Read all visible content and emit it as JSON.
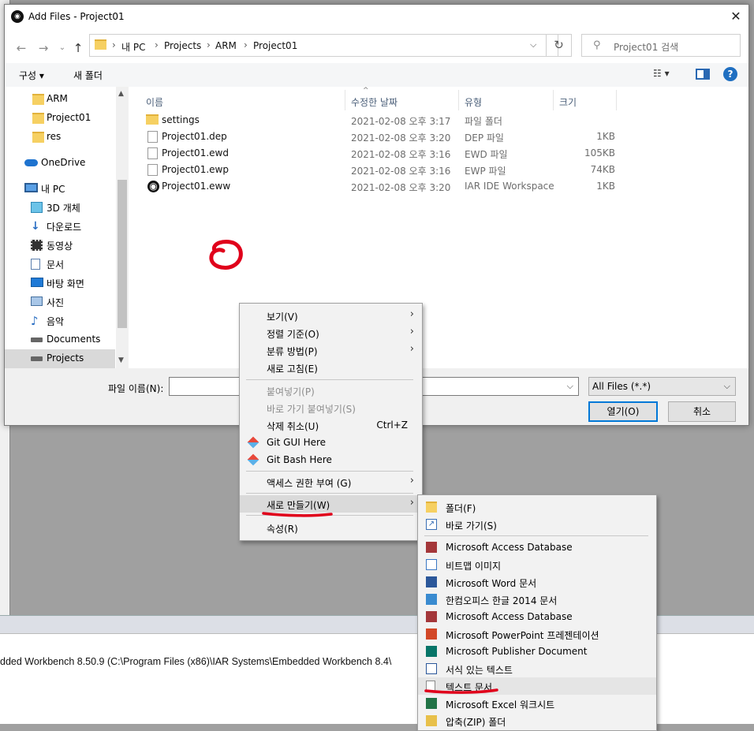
{
  "background": {
    "log_text": "dded Workbench 8.50.9 (C:\\Program Files (x86)\\IAR Systems\\Embedded Workbench 8.4\\"
  },
  "dialog": {
    "title": "Add Files - Project01",
    "close_glyph": "✕",
    "nav": {
      "back": "←",
      "forward": "→",
      "recent": "⌄",
      "up": "↑"
    },
    "breadcrumbs": [
      "내 PC",
      "Projects",
      "ARM",
      "Project01"
    ],
    "refresh_glyph": "↻",
    "search_placeholder": "Project01 검색",
    "toolbar": {
      "organize": "구성 ▾",
      "new_folder": "새 폴더",
      "view": "☷ ▾",
      "help": "?"
    },
    "nav_pane": [
      {
        "label": "ARM",
        "icon": "folder-icon"
      },
      {
        "label": "Project01",
        "icon": "folder-icon"
      },
      {
        "label": "res",
        "icon": "folder-icon"
      },
      {
        "label": "OneDrive",
        "icon": "cloud-icon"
      },
      {
        "label": "내 PC",
        "icon": "pc-icon"
      },
      {
        "label": "3D 개체",
        "icon": "cube-icon"
      },
      {
        "label": "다운로드",
        "icon": "download-icon"
      },
      {
        "label": "동영상",
        "icon": "video-icon"
      },
      {
        "label": "문서",
        "icon": "document-icon"
      },
      {
        "label": "바탕 화면",
        "icon": "desktop-icon"
      },
      {
        "label": "사진",
        "icon": "picture-icon"
      },
      {
        "label": "음악",
        "icon": "music-icon"
      },
      {
        "label": "Documents",
        "icon": "drive-icon"
      },
      {
        "label": "Projects",
        "icon": "drive-icon",
        "selected": true
      }
    ],
    "columns": {
      "name": "이름",
      "date": "수정한 날짜",
      "type": "유형",
      "size": "크기"
    },
    "files": [
      {
        "name": "settings",
        "date": "2021-02-08 오후 3:17",
        "type": "파일 폴더",
        "size": "",
        "icon": "folder-icon"
      },
      {
        "name": "Project01.dep",
        "date": "2021-02-08 오후 3:20",
        "type": "DEP 파일",
        "size": "1KB",
        "icon": "file-icon"
      },
      {
        "name": "Project01.ewd",
        "date": "2021-02-08 오후 3:16",
        "type": "EWD 파일",
        "size": "105KB",
        "icon": "file-icon"
      },
      {
        "name": "Project01.ewp",
        "date": "2021-02-08 오후 3:16",
        "type": "EWP 파일",
        "size": "74KB",
        "icon": "file-icon"
      },
      {
        "name": "Project01.eww",
        "date": "2021-02-08 오후 3:20",
        "type": "IAR IDE Workspace",
        "size": "1KB",
        "icon": "iar-workspace-icon"
      }
    ],
    "filename_label": "파일 이름(N):",
    "filename_value": "",
    "filter_value": "All Files (*.*)",
    "open_label": "열기(O)",
    "cancel_label": "취소"
  },
  "context_menu": {
    "items": [
      {
        "label": "보기(V)",
        "submenu": true
      },
      {
        "label": "정렬 기준(O)",
        "submenu": true
      },
      {
        "label": "분류 방법(P)",
        "submenu": true
      },
      {
        "label": "새로 고침(E)"
      },
      {
        "label": "붙여넣기(P)",
        "disabled": true
      },
      {
        "label": "바로 가기 붙여넣기(S)",
        "disabled": true
      },
      {
        "label": "삭제 취소(U)",
        "shortcut": "Ctrl+Z"
      },
      {
        "label": "Git GUI Here",
        "icon": "git-icon"
      },
      {
        "label": "Git Bash Here",
        "icon": "git-icon"
      },
      {
        "label": "액세스 권한 부여 (G)",
        "submenu": true
      },
      {
        "label": "새로 만들기(W)",
        "submenu": true,
        "highlighted": true
      },
      {
        "label": "속성(R)"
      }
    ],
    "arrow_glyph": "›"
  },
  "new_submenu": {
    "items": [
      {
        "label": "폴더(F)",
        "icon": "folder-icon",
        "color": "#f6d062"
      },
      {
        "label": "바로 가기(S)",
        "icon": "shortcut-icon",
        "color": "#3a6fb5"
      },
      {
        "label": "Microsoft Access Database",
        "icon": "access-icon",
        "color": "#a4373a"
      },
      {
        "label": "비트맵 이미지",
        "icon": "bitmap-icon",
        "color": "#3b78c4"
      },
      {
        "label": "Microsoft Word 문서",
        "icon": "word-icon",
        "color": "#2b579a"
      },
      {
        "label": "한컴오피스 한글 2014 문서",
        "icon": "hwp-icon",
        "color": "#3a8bd0"
      },
      {
        "label": "Microsoft Access Database",
        "icon": "access-icon",
        "color": "#a4373a"
      },
      {
        "label": "Microsoft PowerPoint 프레젠테이션",
        "icon": "powerpoint-icon",
        "color": "#d24726"
      },
      {
        "label": "Microsoft Publisher Document",
        "icon": "publisher-icon",
        "color": "#077568"
      },
      {
        "label": "서식 있는 텍스트",
        "icon": "rtf-icon",
        "color": "#2b579a"
      },
      {
        "label": "텍스트 문서",
        "icon": "text-document-icon",
        "color": "#ffffff",
        "highlighted": true
      },
      {
        "label": "Microsoft Excel 워크시트",
        "icon": "excel-icon",
        "color": "#217346"
      },
      {
        "label": "압축(ZIP) 폴더",
        "icon": "zip-folder-icon",
        "color": "#e8c04a"
      }
    ]
  },
  "annotation_color": "#e0001b"
}
